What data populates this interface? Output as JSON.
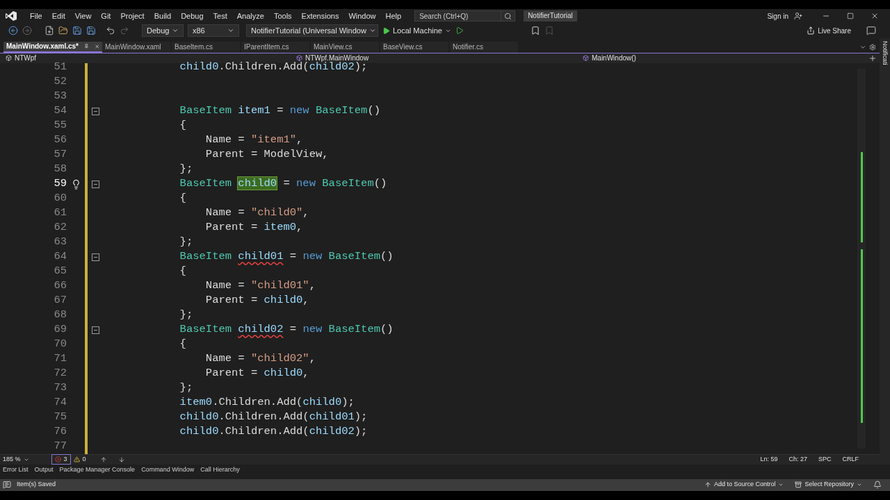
{
  "menu": {
    "items": [
      "File",
      "Edit",
      "View",
      "Git",
      "Project",
      "Build",
      "Debug",
      "Test",
      "Analyze",
      "Tools",
      "Extensions",
      "Window",
      "Help"
    ],
    "search_placeholder": "Search (Ctrl+Q)",
    "solution": "NotifierTutorial",
    "sign_in": "Sign in"
  },
  "toolbar": {
    "configuration": "Debug",
    "platform": "x86",
    "startup_project": "NotifierTutorial (Universal Window",
    "run_target": "Local Machine",
    "live_share": "Live Share"
  },
  "tabs": [
    {
      "label": "MainWindow.xaml.cs*",
      "selected": true
    },
    {
      "label": "MainWindow.xaml",
      "selected": false
    },
    {
      "label": "BaseItem.cs",
      "selected": false
    },
    {
      "label": "IParentItem.cs",
      "selected": false
    },
    {
      "label": "MainView.cs",
      "selected": false
    },
    {
      "label": "BaseView.cs",
      "selected": false
    },
    {
      "label": "Notifier.cs",
      "selected": false
    }
  ],
  "navigation": {
    "project": "NTWpf",
    "class": "NTWpf.MainWindow",
    "member": "MainWindow()"
  },
  "notifications": "Notificati",
  "code_lines": [
    {
      "number": "51",
      "current": false,
      "foldable": false,
      "tokens": [
        {
          "kind": "var",
          "text": "            child0"
        },
        {
          "kind": "plain",
          "text": ".Children.Add("
        },
        {
          "kind": "var",
          "text": "child02"
        },
        {
          "kind": "plain",
          "text": ");"
        }
      ]
    },
    {
      "number": "52",
      "current": false,
      "foldable": false
    },
    {
      "number": "53",
      "current": false,
      "foldable": false
    },
    {
      "number": "54",
      "current": false,
      "foldable": true,
      "tokens": [
        {
          "kind": "type",
          "text": "            BaseItem "
        },
        {
          "kind": "var",
          "text": "item1"
        },
        {
          "kind": "plain",
          "text": " = "
        },
        {
          "kind": "keyword",
          "text": "new "
        },
        {
          "kind": "type",
          "text": "BaseItem"
        },
        {
          "kind": "plain",
          "text": "()"
        }
      ]
    },
    {
      "number": "55",
      "current": false,
      "foldable": false,
      "tokens": [
        {
          "kind": "plain",
          "text": "            {"
        }
      ]
    },
    {
      "number": "56",
      "current": false,
      "foldable": false,
      "tokens": [
        {
          "kind": "plain",
          "text": "                Name = "
        },
        {
          "kind": "string",
          "text": "\"item1\""
        },
        {
          "kind": "plain",
          "text": ","
        }
      ]
    },
    {
      "number": "57",
      "current": false,
      "foldable": false,
      "tokens": [
        {
          "kind": "plain",
          "text": "                Parent = ModelView,"
        }
      ]
    },
    {
      "number": "58",
      "current": false,
      "foldable": false,
      "tokens": [
        {
          "kind": "plain",
          "text": "            };"
        }
      ]
    },
    {
      "number": "59",
      "current": true,
      "foldable": true,
      "lightbulb": true,
      "tokens": [
        {
          "kind": "type",
          "text": "            BaseItem "
        },
        {
          "kind": "var",
          "text": "child0",
          "highlighted": true
        },
        {
          "kind": "plain",
          "text": " = "
        },
        {
          "kind": "keyword",
          "text": "new "
        },
        {
          "kind": "type",
          "text": "BaseItem"
        },
        {
          "kind": "plain",
          "text": "()"
        }
      ]
    },
    {
      "number": "60",
      "current": false,
      "foldable": false,
      "tokens": [
        {
          "kind": "plain",
          "text": "            {"
        }
      ]
    },
    {
      "number": "61",
      "current": false,
      "foldable": false,
      "tokens": [
        {
          "kind": "plain",
          "text": "                Name = "
        },
        {
          "kind": "string",
          "text": "\"child0\""
        },
        {
          "kind": "plain",
          "text": ","
        }
      ]
    },
    {
      "number": "62",
      "current": false,
      "foldable": false,
      "tokens": [
        {
          "kind": "plain",
          "text": "                Parent = "
        },
        {
          "kind": "var",
          "text": "item0"
        },
        {
          "kind": "plain",
          "text": ","
        }
      ]
    },
    {
      "number": "63",
      "current": false,
      "foldable": false,
      "tokens": [
        {
          "kind": "plain",
          "text": "            };"
        }
      ]
    },
    {
      "number": "64",
      "current": false,
      "foldable": true,
      "tokens": [
        {
          "kind": "type",
          "text": "            BaseItem "
        },
        {
          "kind": "var",
          "text": "child01",
          "error": true
        },
        {
          "kind": "plain",
          "text": " = "
        },
        {
          "kind": "keyword",
          "text": "new "
        },
        {
          "kind": "type",
          "text": "BaseItem"
        },
        {
          "kind": "plain",
          "text": "()"
        }
      ]
    },
    {
      "number": "65",
      "current": false,
      "foldable": false,
      "tokens": [
        {
          "kind": "plain",
          "text": "            {"
        }
      ]
    },
    {
      "number": "66",
      "current": false,
      "foldable": false,
      "tokens": [
        {
          "kind": "plain",
          "text": "                Name = "
        },
        {
          "kind": "string",
          "text": "\"child01\""
        },
        {
          "kind": "plain",
          "text": ","
        }
      ]
    },
    {
      "number": "67",
      "current": false,
      "foldable": false,
      "tokens": [
        {
          "kind": "plain",
          "text": "                Parent = "
        },
        {
          "kind": "var",
          "text": "child0"
        },
        {
          "kind": "plain",
          "text": ","
        }
      ]
    },
    {
      "number": "68",
      "current": false,
      "foldable": false,
      "tokens": [
        {
          "kind": "plain",
          "text": "            };"
        }
      ]
    },
    {
      "number": "69",
      "current": false,
      "foldable": true,
      "tokens": [
        {
          "kind": "type",
          "text": "            BaseItem "
        },
        {
          "kind": "var",
          "text": "child02",
          "error": true
        },
        {
          "kind": "plain",
          "text": " = "
        },
        {
          "kind": "keyword",
          "text": "new "
        },
        {
          "kind": "type",
          "text": "BaseItem"
        },
        {
          "kind": "plain",
          "text": "()"
        }
      ]
    },
    {
      "number": "70",
      "current": false,
      "foldable": false,
      "tokens": [
        {
          "kind": "plain",
          "text": "            {"
        }
      ]
    },
    {
      "number": "71",
      "current": false,
      "foldable": false,
      "tokens": [
        {
          "kind": "plain",
          "text": "                Name = "
        },
        {
          "kind": "string",
          "text": "\"child02\""
        },
        {
          "kind": "plain",
          "text": ","
        }
      ]
    },
    {
      "number": "72",
      "current": false,
      "foldable": false,
      "tokens": [
        {
          "kind": "plain",
          "text": "                Parent = "
        },
        {
          "kind": "var",
          "text": "child0"
        },
        {
          "kind": "plain",
          "text": ","
        }
      ]
    },
    {
      "number": "73",
      "current": false,
      "foldable": false,
      "tokens": [
        {
          "kind": "plain",
          "text": "            };"
        }
      ]
    },
    {
      "number": "74",
      "current": false,
      "foldable": false,
      "tokens": [
        {
          "kind": "var",
          "text": "            item0"
        },
        {
          "kind": "plain",
          "text": ".Children.Add("
        },
        {
          "kind": "var",
          "text": "child0"
        },
        {
          "kind": "plain",
          "text": ");"
        }
      ]
    },
    {
      "number": "75",
      "current": false,
      "foldable": false,
      "tokens": [
        {
          "kind": "var",
          "text": "            child0"
        },
        {
          "kind": "plain",
          "text": ".Children.Add("
        },
        {
          "kind": "var",
          "text": "child01"
        },
        {
          "kind": "plain",
          "text": ");"
        }
      ]
    },
    {
      "number": "76",
      "current": false,
      "foldable": false,
      "tokens": [
        {
          "kind": "var",
          "text": "            child0"
        },
        {
          "kind": "plain",
          "text": ".Children.Add("
        },
        {
          "kind": "var",
          "text": "child02"
        },
        {
          "kind": "plain",
          "text": ");"
        }
      ]
    },
    {
      "number": "77",
      "current": false,
      "foldable": false
    }
  ],
  "editor_status": {
    "zoom": "185 %",
    "errors": "3",
    "warnings": "0",
    "line": "Ln: 59",
    "column": "Ch: 27",
    "whitespace": "SPC",
    "line_ending": "CRLF"
  },
  "tool_tabs": [
    "Error List",
    "Output",
    "Package Manager Console",
    "Command Window",
    "Call Hierarchy"
  ],
  "status_bar": {
    "message": "Item(s) Saved",
    "source_control": "Add to Source Control",
    "repository": "Select Repository"
  }
}
